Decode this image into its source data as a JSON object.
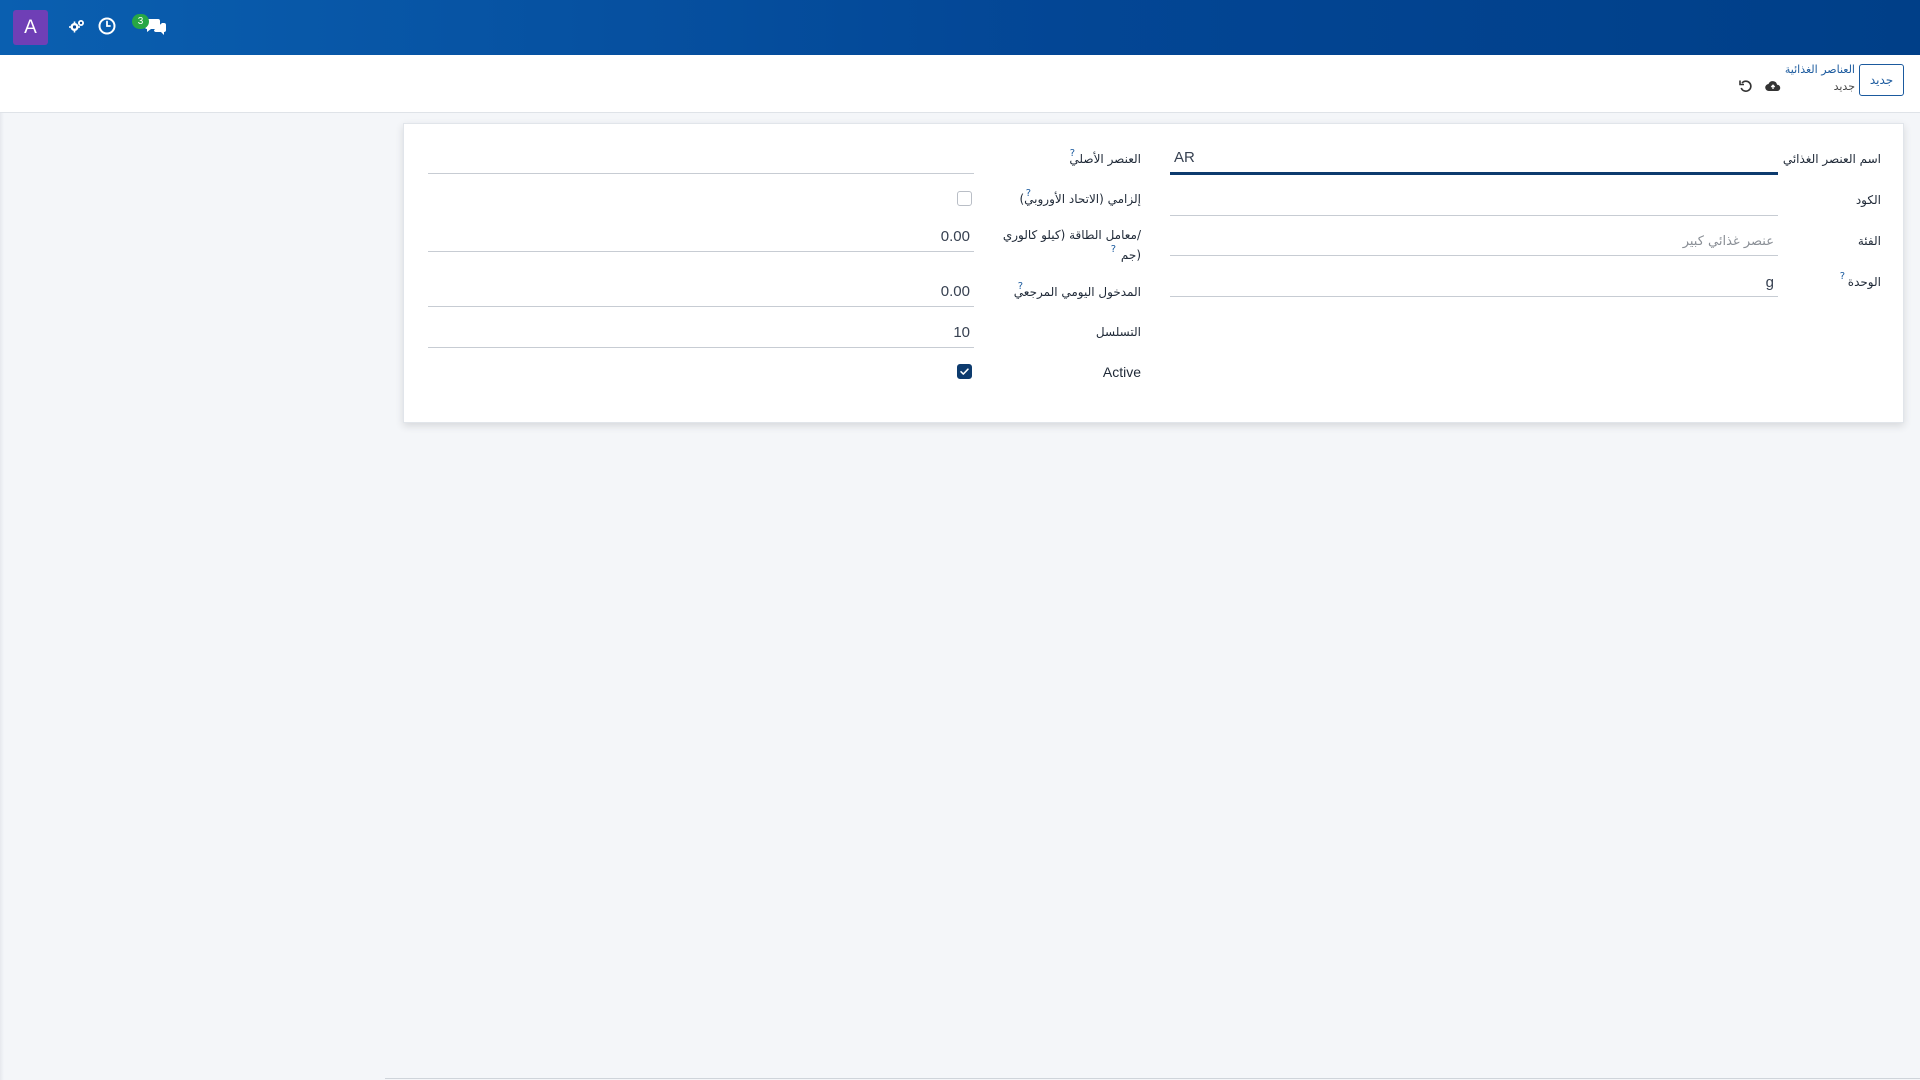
{
  "navbar": {
    "avatar_letter": "A",
    "icons": [
      "settings-gears-icon",
      "clock-icon",
      "chat-icon"
    ],
    "chat_badge": "3",
    "colors": {
      "bar": "#034695",
      "avatar": "#6f3fb6",
      "badge": "#27a745"
    }
  },
  "control_panel": {
    "new_button": "جديد",
    "breadcrumb_parent": "العناصر الغذائية",
    "breadcrumb_current": "جديد",
    "icons": [
      "cloud-upload-icon",
      "undo-icon"
    ]
  },
  "form": {
    "right_column": {
      "name": {
        "label": "اسم العنصر الغذائي",
        "value": "AR"
      },
      "code": {
        "label": "الكود",
        "value": ""
      },
      "category": {
        "label": "الفئة",
        "placeholder": "عنصر غذائي كبير"
      },
      "unit": {
        "label": "الوحدة",
        "help": "?",
        "value": "g"
      }
    },
    "left_column": {
      "parent": {
        "label": "العنصر الأصلي",
        "help": "?",
        "value": ""
      },
      "eu_mandatory": {
        "label": "إلزامي (الاتحاد الأوروبي)",
        "help": "?",
        "checked": false
      },
      "energy_factor": {
        "label_line1": "معامل الطاقة (كيلو كالوري/",
        "label_line2": "جم)",
        "help": "?",
        "value": "0.00"
      },
      "daily_intake": {
        "label": "المدخول اليومي المرجعي",
        "help": "?",
        "value": "0.00"
      },
      "sequence": {
        "label": "التسلسل",
        "value": "10"
      },
      "active": {
        "label": "Active",
        "checked": true
      }
    }
  }
}
